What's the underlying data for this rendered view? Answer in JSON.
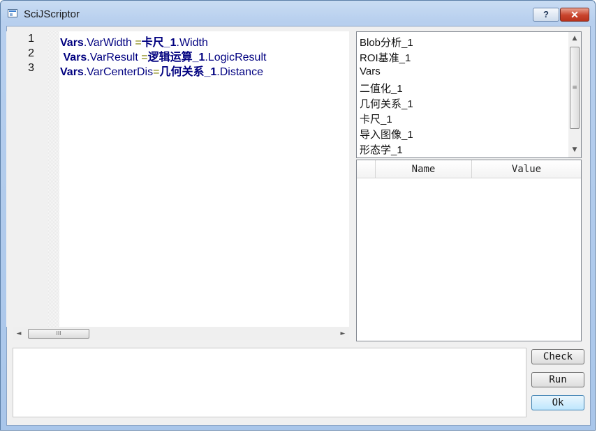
{
  "window": {
    "title": "SciJScriptor",
    "help_label": "?",
    "close_label": "✕"
  },
  "editor": {
    "lines": [
      {
        "number": "1",
        "obj": "Vars",
        "dot": ".",
        "field": "VarWidth ",
        "op": "=",
        "ref": "卡尺_1",
        "dot2": ".",
        "member": "Width"
      },
      {
        "number": "2",
        "obj": " Vars",
        "dot": ".",
        "field": "VarResult ",
        "op": "=",
        "ref": "逻辑运算_1",
        "dot2": ".",
        "member": "LogicResult"
      },
      {
        "number": "3",
        "obj": "Vars",
        "dot": ".",
        "field": "VarCenterDis",
        "op": "=",
        "ref": "几何关系_1",
        "dot2": ".",
        "member": "Distance"
      }
    ],
    "hscroll": {
      "left_arrow": "◄",
      "right_arrow": "►",
      "thumb_grip": "III"
    }
  },
  "object_list": {
    "items": [
      "Blob分析_1",
      "ROI基准_1",
      "Vars",
      "二值化_1",
      "几何关系_1",
      "卡尺_1",
      "导入图像_1",
      "形态学_1"
    ],
    "vscroll": {
      "up_arrow": "▲",
      "down_arrow": "▼",
      "thumb_grip": "≡"
    }
  },
  "property_table": {
    "columns": [
      "Name",
      "Value"
    ]
  },
  "output": {
    "text": ""
  },
  "buttons": {
    "check": "Check",
    "run": "Run",
    "ok": "Ok"
  }
}
